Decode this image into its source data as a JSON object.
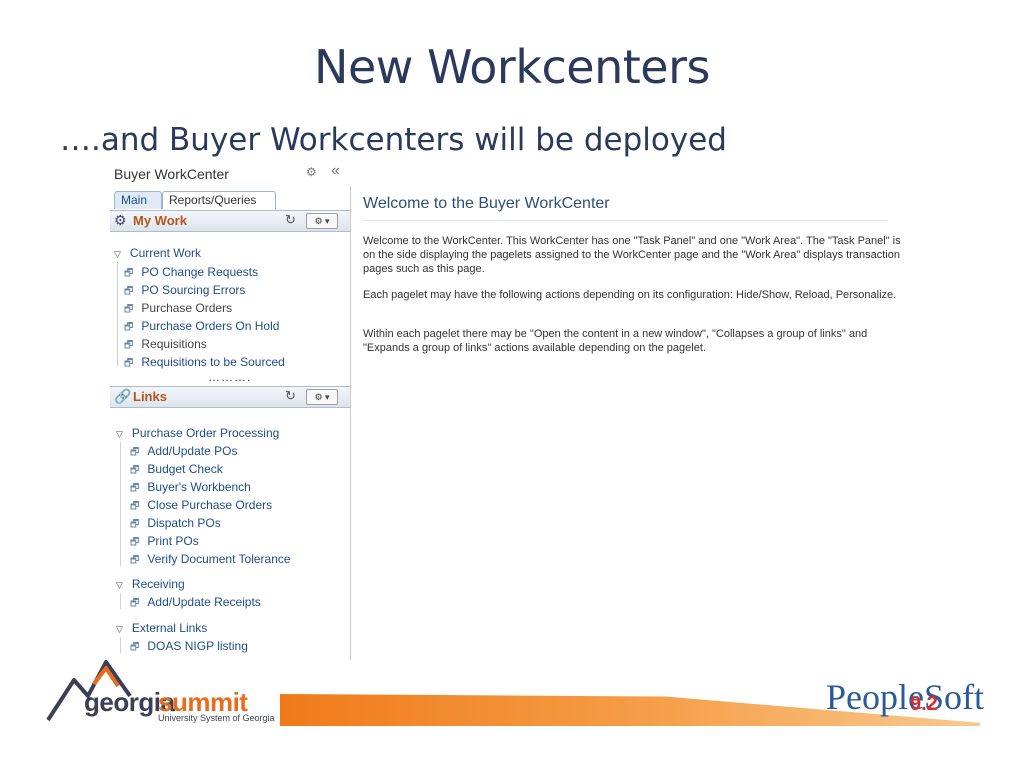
{
  "slide": {
    "title": "New Workcenters",
    "subtitle": "….and Buyer Workcenters will be deployed"
  },
  "panel": {
    "title": "Buyer WorkCenter",
    "tabs": [
      {
        "label": "Main",
        "active": true
      },
      {
        "label": "Reports/Queries",
        "active": false
      }
    ],
    "my_work": {
      "title": "My Work",
      "group": {
        "title": "Current Work",
        "items": [
          {
            "label": "PO Change Requests",
            "link": true
          },
          {
            "label": "PO Sourcing Errors",
            "link": true
          },
          {
            "label": "Purchase Orders",
            "link": false
          },
          {
            "label": "Purchase Orders On Hold",
            "link": true
          },
          {
            "label": "Requisitions",
            "link": false
          },
          {
            "label": "Requisitions to be Sourced",
            "link": true
          }
        ]
      },
      "more": "………."
    },
    "links": {
      "title": "Links",
      "groups": [
        {
          "title": "Purchase Order Processing",
          "items": [
            "Add/Update POs",
            "Budget Check",
            "Buyer's Workbench",
            "Close Purchase Orders",
            "Dispatch POs",
            "Print POs",
            "Verify Document Tolerance"
          ]
        },
        {
          "title": "Receiving",
          "items": [
            "Add/Update Receipts"
          ]
        },
        {
          "title": "External Links",
          "items": [
            "DOAS NIGP listing"
          ]
        }
      ]
    }
  },
  "work_area": {
    "title": "Welcome to the Buyer WorkCenter",
    "paragraphs": [
      "Welcome to the WorkCenter. This WorkCenter has one \"Task Panel\" and one \"Work Area\". The \"Task Panel\" is on the side displaying the pagelets assigned to the WorkCenter page and the \"Work Area\" displays transaction pages such as this page.",
      "Each pagelet may have the following actions depending on its configuration: Hide/Show, Reload, Personalize.",
      "Within each pagelet there may be \"Open the content in a new window\", \"Collapses a group of links\" and \"Expands a group of links\" actions available depending on the pagelet."
    ]
  },
  "footer": {
    "logo_georgia": "georgia",
    "logo_summit": "summit",
    "logo_tagline": "University System of Georgia",
    "peoplesoft": "PeopleSoft",
    "peoplesoft_version": "9.2"
  },
  "colors": {
    "title": "#2b3a5c",
    "link": "#1f4e8c",
    "pagelet_title": "#b5561a",
    "accent_orange": "#f07a1a"
  }
}
